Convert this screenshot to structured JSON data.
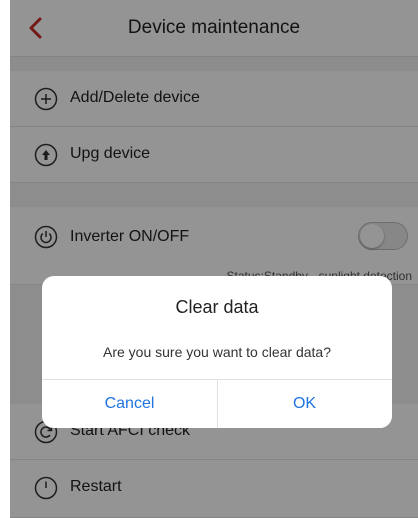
{
  "header": {
    "title": "Device maintenance",
    "back_icon": "chevron-left-icon",
    "accent_color": "#c62828"
  },
  "items": [
    {
      "label": "Add/Delete device",
      "icon": "plus-circle-icon"
    },
    {
      "label": "Upg device",
      "icon": "upload-circle-icon"
    },
    {
      "label": "Inverter ON/OFF",
      "icon": "power-icon",
      "status": "Status:Standby - sunlight detection",
      "toggle_on": false
    },
    {
      "label": "Start AFCI check",
      "icon": "refresh-circle-icon"
    },
    {
      "label": "Restart",
      "icon": "power-icon"
    }
  ],
  "dialog": {
    "title": "Clear data",
    "message": "Are you sure you want to clear data?",
    "cancel_label": "Cancel",
    "ok_label": "OK",
    "button_color": "#1f74e0"
  }
}
